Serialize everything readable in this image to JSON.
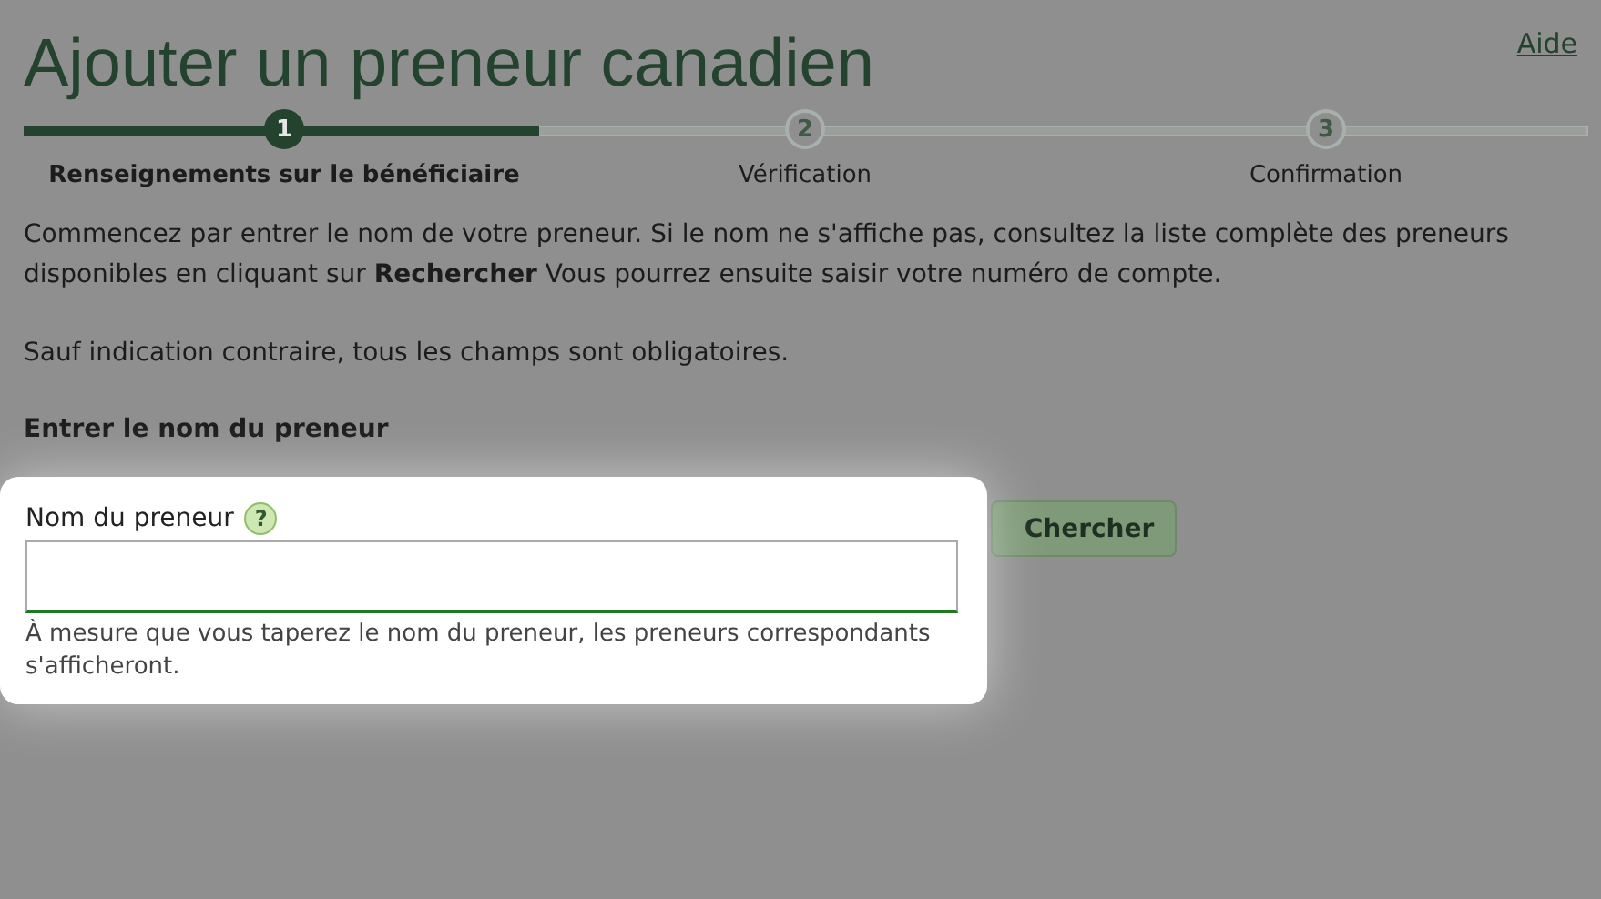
{
  "title": "Ajouter un preneur canadien",
  "help_link": "Aide",
  "stepper": {
    "level": 0.33,
    "steps": [
      {
        "number": "1",
        "label": "Renseignements sur le bénéficiaire",
        "selected": true
      },
      {
        "number": "2",
        "label": "Vérification",
        "selected": false
      },
      {
        "number": "3",
        "label": "Confirmation",
        "selected": false
      }
    ]
  },
  "intro": "Commencez par entrer le nom de votre preneur. Si le nom ne s'affiche pas, consultez la liste complète des preneurs disponibles en cliquant sur **Rechercher** Vous pourrez ensuite saisir votre numéro de compte.",
  "required_note": "Sauf indication contraire, tous les champs sont obligatoires.",
  "section_heading": "Entrer le nom du preneur",
  "search_button": "Chercher",
  "spotlight": {
    "label": "Nom du preneur",
    "help_icon": "?",
    "hint": "À mesure que vous taperez le nom du preneur, les preneurs correspondants s'afficheront."
  }
}
